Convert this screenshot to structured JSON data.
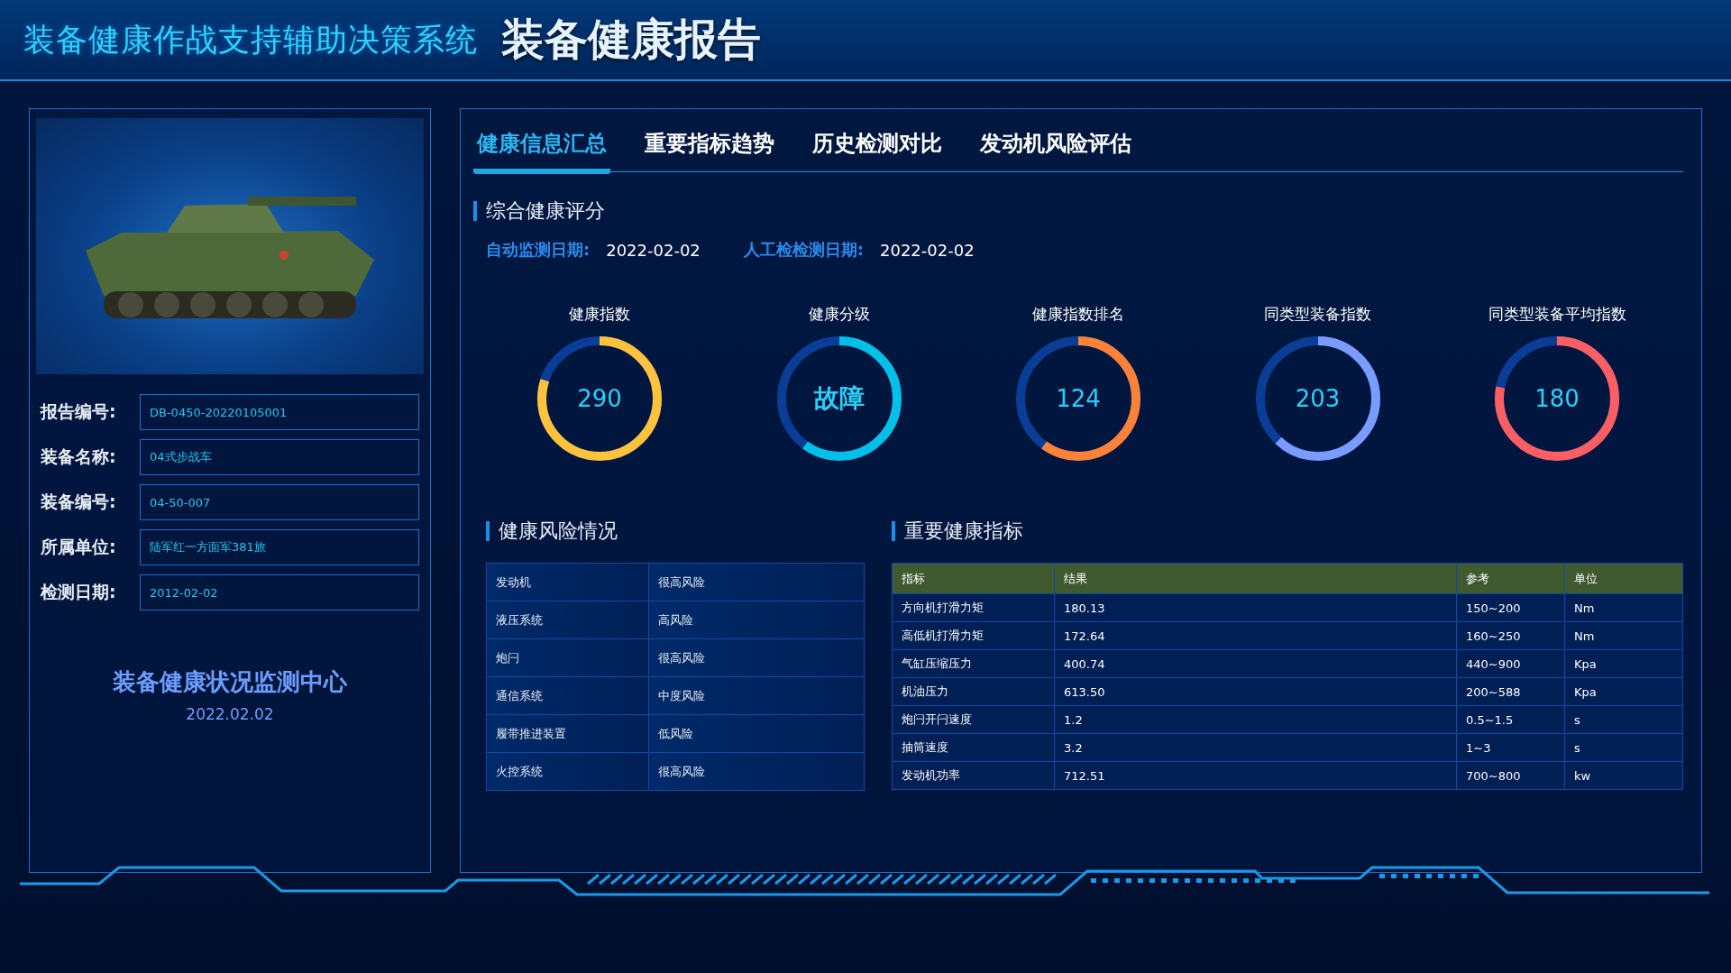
{
  "header": {
    "system_title": "装备健康作战支持辅助决策系统",
    "page_title": "装备健康报告"
  },
  "equipment": {
    "fields": [
      {
        "label": "报告编号:",
        "value": "DB-0450-20220105001"
      },
      {
        "label": "装备名称:",
        "value": "04式步战车"
      },
      {
        "label": "装备编号:",
        "value": "04-50-007"
      },
      {
        "label": "所属单位:",
        "value": "陆军红一方面军381旅"
      },
      {
        "label": "检测日期:",
        "value": "2012-02-02"
      }
    ],
    "center_name": "装备健康状况监测中心",
    "center_date": "2022.02.02"
  },
  "tabs": [
    {
      "label": "健康信息汇总",
      "selected": true
    },
    {
      "label": "重要指标趋势",
      "selected": false
    },
    {
      "label": "历史检测对比",
      "selected": false
    },
    {
      "label": "发动机风险评估",
      "selected": false
    }
  ],
  "score_section": {
    "title": "综合健康评分",
    "dates": [
      {
        "label": "自动监测日期:",
        "value": "2022-02-02"
      },
      {
        "label": "人工检检测日期:",
        "value": "2022-02-02"
      }
    ],
    "gauges": [
      {
        "label": "健康指数",
        "value": "290",
        "level": 0.8,
        "color": "#ffc23d"
      },
      {
        "label": "健康分级",
        "value": "故障",
        "level": 0.6,
        "color": "#00c0e8"
      },
      {
        "label": "健康指数排名",
        "value": "124",
        "level": 0.6,
        "color": "#ff8238"
      },
      {
        "label": "同类型装备指数",
        "value": "203",
        "level": 0.62,
        "color": "#7a9bff"
      },
      {
        "label": "同类型装备平均指数",
        "value": "180",
        "level": 0.78,
        "color": "#ff5e62"
      }
    ]
  },
  "risk_section": {
    "title": "健康风险情况",
    "rows": [
      [
        "发动机",
        "很高风险"
      ],
      [
        "液压系统",
        "高风险"
      ],
      [
        "炮闩",
        "很高风险"
      ],
      [
        "通信系统",
        "中度风险"
      ],
      [
        "履带推进装置",
        "低风险"
      ],
      [
        "火控系统",
        "很高风险"
      ]
    ]
  },
  "indicator_section": {
    "title": "重要健康指标",
    "columns": [
      "指标",
      "结果",
      "参考",
      "单位"
    ],
    "rows": [
      [
        "方向机打滑力矩",
        "180.13",
        "150~200",
        "Nm"
      ],
      [
        "高低机打滑力矩",
        "172.64",
        "160~250",
        "Nm"
      ],
      [
        "气缸压缩压力",
        "400.74",
        "440~900",
        "Kpa"
      ],
      [
        "机油压力",
        "613.50",
        "200~588",
        "Kpa"
      ],
      [
        "炮闩开闩速度",
        "1.2",
        "0.5~1.5",
        "s"
      ],
      [
        "抽筒速度",
        "3.2",
        "1~3",
        "s"
      ],
      [
        "发动机功率",
        "712.51",
        "700~800",
        "kw"
      ]
    ]
  }
}
